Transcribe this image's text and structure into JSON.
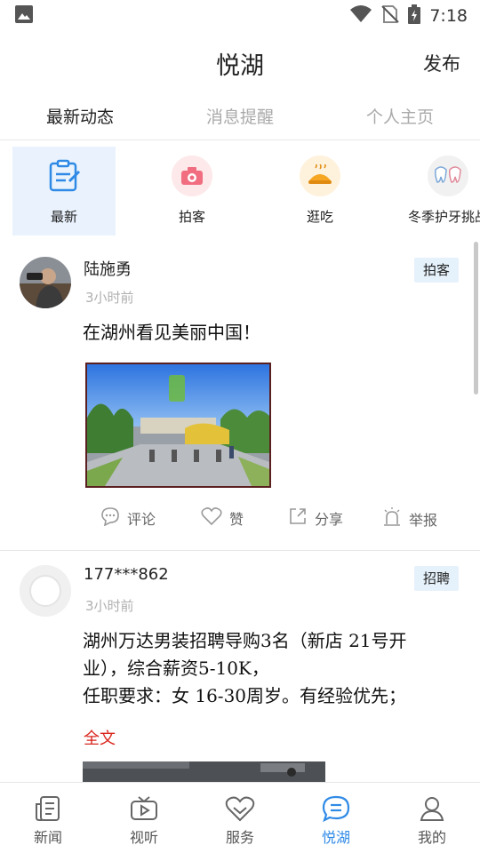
{
  "status_bar": {
    "time": "7:18"
  },
  "header": {
    "title": "悦湖",
    "publish_label": "发布"
  },
  "tabs": [
    {
      "label": "最新动态",
      "active": true
    },
    {
      "label": "消息提醒",
      "active": false
    },
    {
      "label": "个人主页",
      "active": false
    }
  ],
  "channels": [
    {
      "label": "最新",
      "icon": "note-icon"
    },
    {
      "label": "拍客",
      "icon": "camera-icon"
    },
    {
      "label": "逛吃",
      "icon": "food-icon"
    },
    {
      "label": "冬季护牙挑战",
      "icon": "tooth-icon"
    }
  ],
  "posts": [
    {
      "author": "陆施勇",
      "time": "3小时前",
      "badge": "拍客",
      "text": "在湖州看见美丽中国！",
      "actions": {
        "comment": "评论",
        "like": "赞",
        "share": "分享",
        "report": "举报"
      }
    },
    {
      "author": "177***862",
      "time": "3小时前",
      "badge": "招聘",
      "text_lines": [
        "湖州万达男装招聘导购3名（新店 21号开",
        "业），综合薪资5-10K，",
        "任职要求：女 16-30周岁。有经验优先；"
      ],
      "full_text_link": "全文"
    }
  ],
  "bottom_nav": [
    {
      "label": "新闻",
      "active": false
    },
    {
      "label": "视听",
      "active": false
    },
    {
      "label": "服务",
      "active": false
    },
    {
      "label": "悦湖",
      "active": true
    },
    {
      "label": "我的",
      "active": false
    }
  ],
  "colors": {
    "accent": "#2f8ae6",
    "link_red": "#d9261c",
    "badge_bg": "#e6f2fb"
  }
}
